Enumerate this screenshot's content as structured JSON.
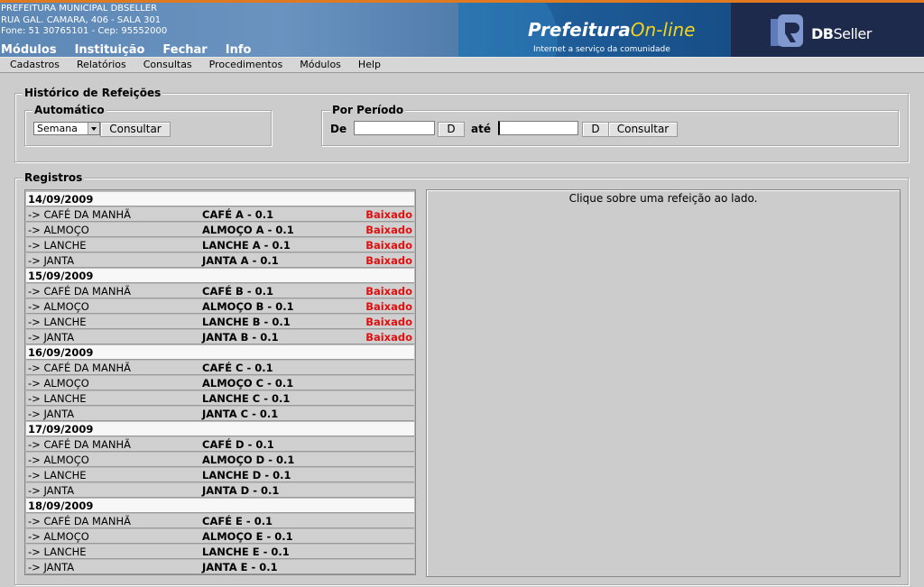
{
  "header": {
    "org_lines": [
      "PREFEITURA MUNICIPAL DBSELLER",
      "RUA GAL. CAMARA, 406 - SALA 301",
      "Fone: 51 30765101  -  Cep: 95552000"
    ],
    "main_menu": [
      "Módulos",
      "Instituição",
      "Fechar",
      "Info"
    ],
    "promo_title_a": "Prefeitura",
    "promo_title_b": "On-line",
    "promo_sub": "Internet a serviço da comunidade",
    "logo_b": "DB",
    "logo_r": "Seller",
    "colors": {
      "banner": "#5a86b6",
      "accent_line": "#e07a20",
      "status_red": "#e01010"
    }
  },
  "menubar": [
    "Cadastros",
    "Relatórios",
    "Consultas",
    "Procedimentos",
    "Módulos",
    "Help"
  ],
  "historico": {
    "title": "Histórico de Refeições",
    "automatico": {
      "legend": "Automático",
      "select_value": "Semana",
      "button": "Consultar"
    },
    "periodo": {
      "legend": "Por Período",
      "de_label": "De",
      "ate_label": "até",
      "de_value": "",
      "ate_value": "",
      "date_button": "D",
      "button": "Consultar"
    }
  },
  "registros": {
    "title": "Registros",
    "days": [
      {
        "date": "14/09/2009",
        "meals": [
          {
            "meal": "-> CAFÉ DA MANHÃ",
            "dish": "CAFÉ A - 0.1",
            "status": "Baixado"
          },
          {
            "meal": "-> ALMOÇO",
            "dish": "ALMOÇO A - 0.1",
            "status": "Baixado"
          },
          {
            "meal": "-> LANCHE",
            "dish": "LANCHE A - 0.1",
            "status": "Baixado"
          },
          {
            "meal": "-> JANTA",
            "dish": "JANTA A - 0.1",
            "status": "Baixado"
          }
        ]
      },
      {
        "date": "15/09/2009",
        "meals": [
          {
            "meal": "-> CAFÉ DA MANHÃ",
            "dish": "CAFÉ B - 0.1",
            "status": "Baixado"
          },
          {
            "meal": "-> ALMOÇO",
            "dish": "ALMOÇO B - 0.1",
            "status": "Baixado"
          },
          {
            "meal": "-> LANCHE",
            "dish": "LANCHE B - 0.1",
            "status": "Baixado"
          },
          {
            "meal": "-> JANTA",
            "dish": "JANTA B - 0.1",
            "status": "Baixado"
          }
        ]
      },
      {
        "date": "16/09/2009",
        "meals": [
          {
            "meal": "-> CAFÉ DA MANHÃ",
            "dish": "CAFÉ C - 0.1",
            "status": ""
          },
          {
            "meal": "-> ALMOÇO",
            "dish": "ALMOÇO C - 0.1",
            "status": ""
          },
          {
            "meal": "-> LANCHE",
            "dish": "LANCHE C - 0.1",
            "status": ""
          },
          {
            "meal": "-> JANTA",
            "dish": "JANTA C - 0.1",
            "status": ""
          }
        ]
      },
      {
        "date": "17/09/2009",
        "meals": [
          {
            "meal": "-> CAFÉ DA MANHÃ",
            "dish": "CAFÉ D - 0.1",
            "status": ""
          },
          {
            "meal": "-> ALMOÇO",
            "dish": "ALMOÇO D - 0.1",
            "status": ""
          },
          {
            "meal": "-> LANCHE",
            "dish": "LANCHE D - 0.1",
            "status": ""
          },
          {
            "meal": "-> JANTA",
            "dish": "JANTA D - 0.1",
            "status": ""
          }
        ]
      },
      {
        "date": "18/09/2009",
        "meals": [
          {
            "meal": "-> CAFÉ DA MANHÃ",
            "dish": "CAFÉ E - 0.1",
            "status": ""
          },
          {
            "meal": "-> ALMOÇO",
            "dish": "ALMOÇO E - 0.1",
            "status": ""
          },
          {
            "meal": "-> LANCHE",
            "dish": "LANCHE E - 0.1",
            "status": ""
          },
          {
            "meal": "-> JANTA",
            "dish": "JANTA E - 0.1",
            "status": ""
          }
        ]
      }
    ],
    "detail_hint": "Clique sobre uma refeição ao lado."
  }
}
